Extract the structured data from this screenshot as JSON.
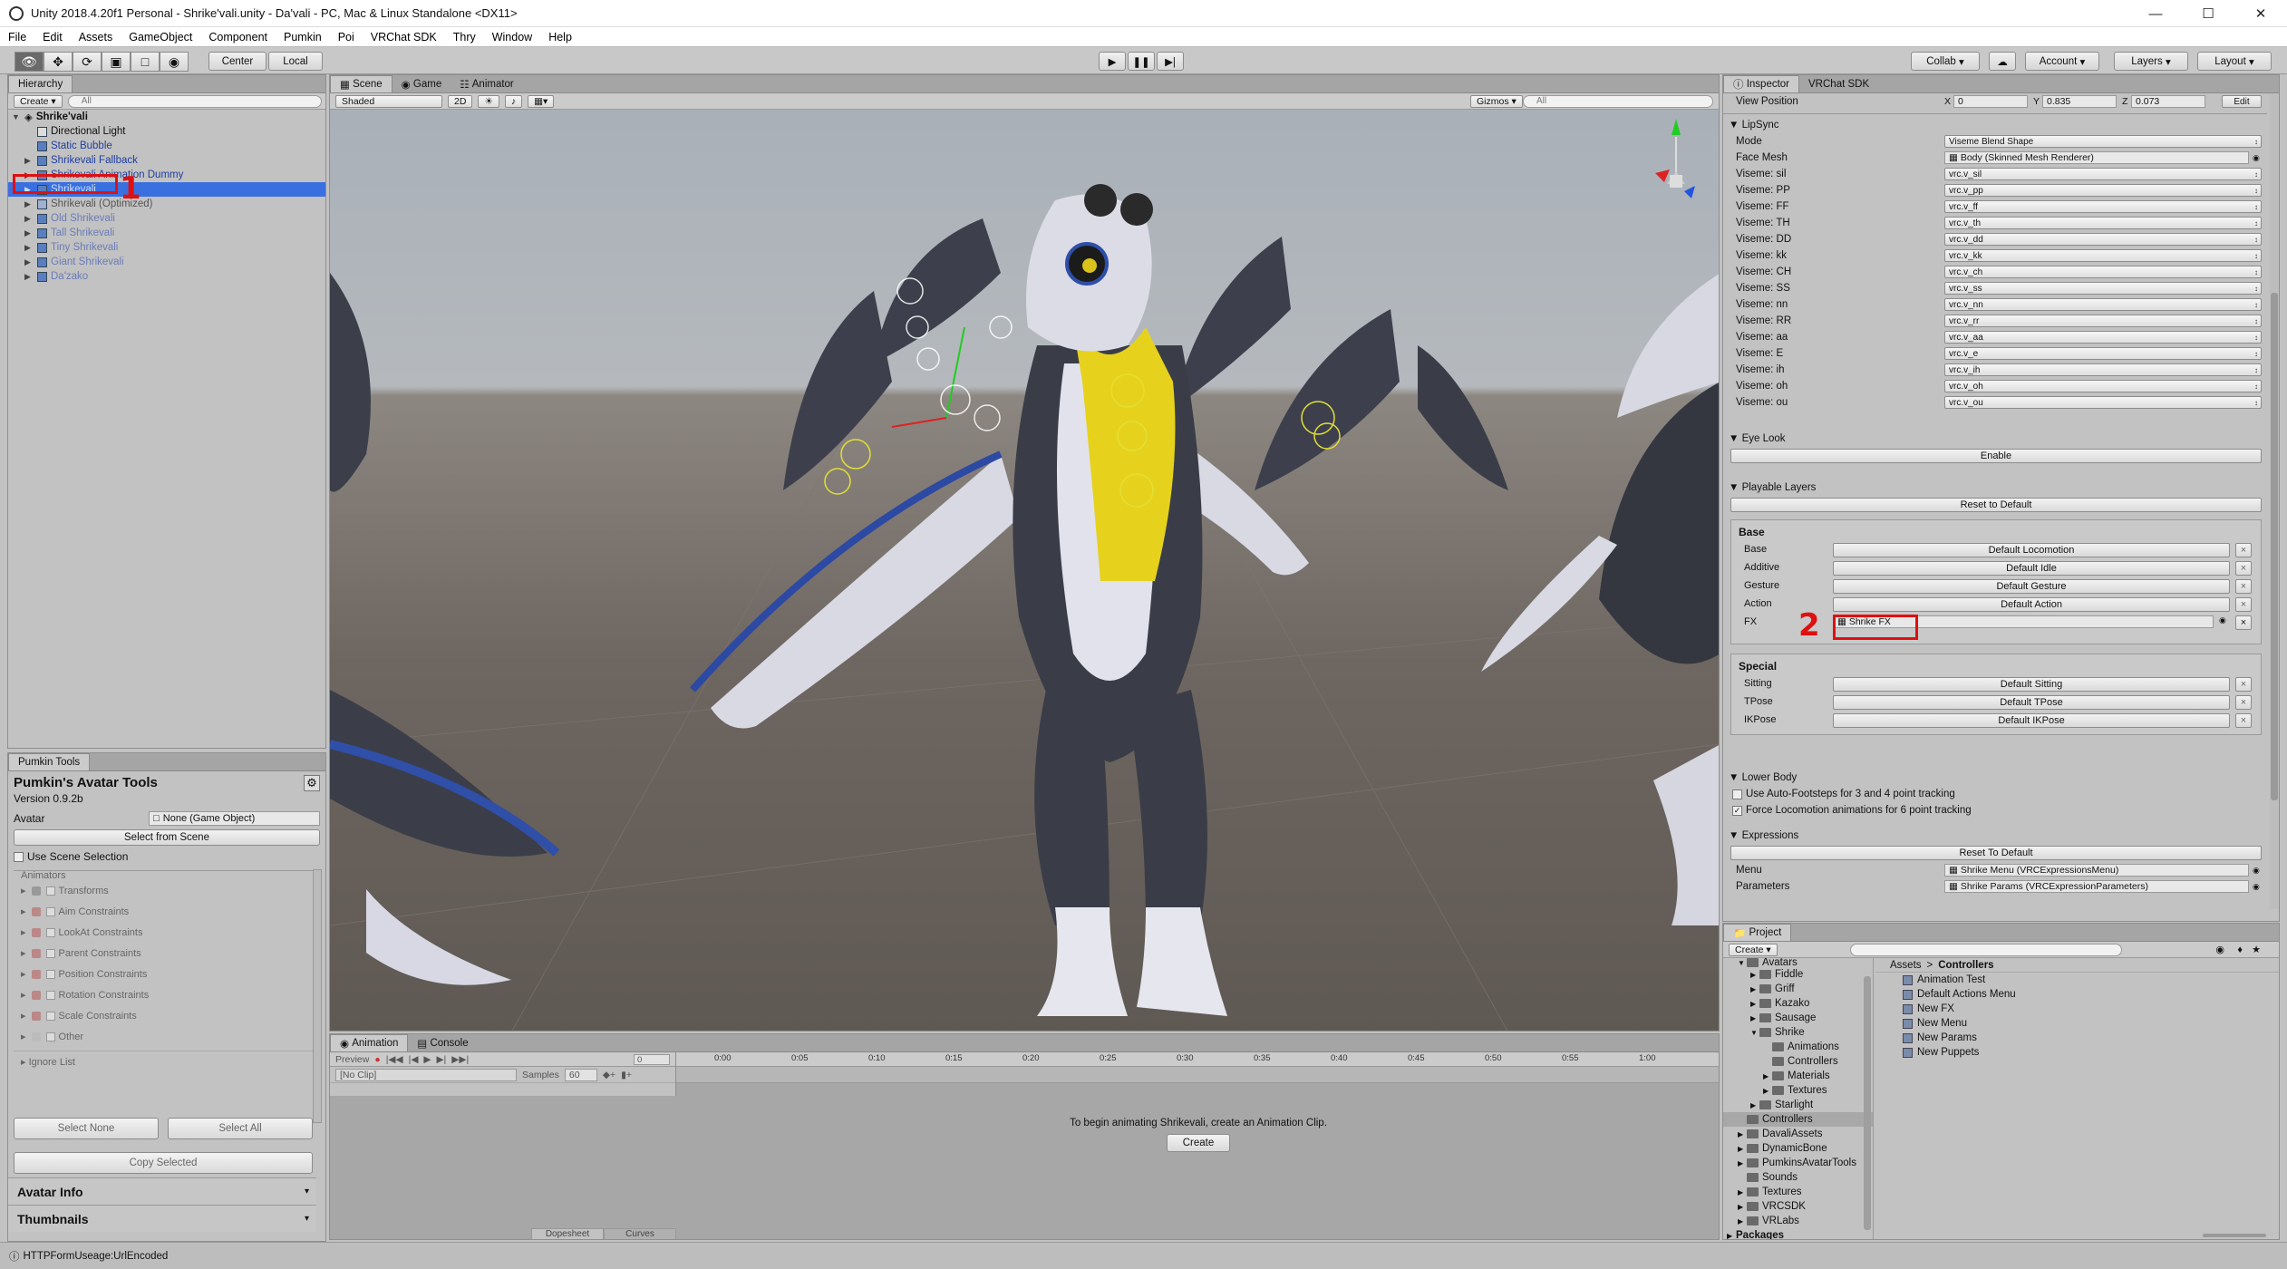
{
  "window": {
    "title": "Unity 2018.4.20f1 Personal - Shrike'vali.unity - Da'vali - PC, Mac & Linux Standalone <DX11>"
  },
  "menu": [
    "File",
    "Edit",
    "Assets",
    "GameObject",
    "Component",
    "Pumkin",
    "Poi",
    "VRChat SDK",
    "Thry",
    "Window",
    "Help"
  ],
  "toolbar": {
    "pivot": "Center",
    "space": "Local",
    "collab": "Collab",
    "account": "Account",
    "layers": "Layers",
    "layout": "Layout"
  },
  "hierarchy": {
    "tab": "Hierarchy",
    "create": "Create",
    "search_placeholder": "All",
    "root": "Shrike'vali",
    "items": [
      {
        "label": "Directional Light"
      },
      {
        "label": "Static Bubble"
      },
      {
        "label": "Shrikevali Fallback"
      },
      {
        "label": "Shrikevali Animation Dummy"
      },
      {
        "label": "Shrikevali"
      },
      {
        "label": "Shrikevali (Optimized)"
      },
      {
        "label": "Old Shrikevali"
      },
      {
        "label": "Tall Shrikevali"
      },
      {
        "label": "Tiny Shrikevali"
      },
      {
        "label": "Giant Shrikevali"
      },
      {
        "label": "Da'zako"
      }
    ]
  },
  "pumkin": {
    "tab": "Pumkin Tools",
    "title": "Pumkin's Avatar Tools",
    "version": "Version 0.9.2b",
    "avatar_label": "Avatar",
    "avatar_value": "None (Game Object)",
    "select_from_scene": "Select from Scene",
    "use_scene_selection": "Use Scene Selection",
    "list": [
      "Animators",
      "Transforms",
      "Aim Constraints",
      "LookAt Constraints",
      "Parent Constraints",
      "Position Constraints",
      "Rotation Constraints",
      "Scale Constraints",
      "Other"
    ],
    "ignore_list": "Ignore List",
    "select_none": "Select None",
    "select_all": "Select All",
    "copy_selected": "Copy Selected",
    "avatar_info": "Avatar Info",
    "thumbnails": "Thumbnails"
  },
  "scene": {
    "tabs": [
      "Scene",
      "Game",
      "Animator"
    ],
    "shading": "Shaded",
    "mode_2d": "2D",
    "gizmos": "Gizmos",
    "search_placeholder": "All"
  },
  "animation": {
    "tabs": [
      "Animation",
      "Console"
    ],
    "preview": "Preview",
    "clip": "[No Clip]",
    "samples_label": "Samples",
    "samples_value": "60",
    "frame": "0",
    "ticks": [
      "0:00",
      "0:05",
      "0:10",
      "0:15",
      "0:20",
      "0:25",
      "0:30",
      "0:35",
      "0:40",
      "0:45",
      "0:50",
      "0:55",
      "1:00"
    ],
    "message": "To begin animating Shrikevali, create an Animation Clip.",
    "create": "Create",
    "dopesheet": "Dopesheet",
    "curves": "Curves"
  },
  "inspector": {
    "tabs": [
      "Inspector",
      "VRChat SDK"
    ],
    "view_position": {
      "label": "View Position",
      "x": "0",
      "y": "0.835",
      "z": "0.073",
      "edit": "Edit"
    },
    "lipsync": {
      "title": "LipSync",
      "mode_label": "Mode",
      "mode_value": "Viseme Blend Shape",
      "face_mesh_label": "Face Mesh",
      "face_mesh_value": "Body (Skinned Mesh Renderer)",
      "visemes": [
        {
          "label": "Viseme: sil",
          "value": "vrc.v_sil"
        },
        {
          "label": "Viseme: PP",
          "value": "vrc.v_pp"
        },
        {
          "label": "Viseme: FF",
          "value": "vrc.v_ff"
        },
        {
          "label": "Viseme: TH",
          "value": "vrc.v_th"
        },
        {
          "label": "Viseme: DD",
          "value": "vrc.v_dd"
        },
        {
          "label": "Viseme: kk",
          "value": "vrc.v_kk"
        },
        {
          "label": "Viseme: CH",
          "value": "vrc.v_ch"
        },
        {
          "label": "Viseme: SS",
          "value": "vrc.v_ss"
        },
        {
          "label": "Viseme: nn",
          "value": "vrc.v_nn"
        },
        {
          "label": "Viseme: RR",
          "value": "vrc.v_rr"
        },
        {
          "label": "Viseme: aa",
          "value": "vrc.v_aa"
        },
        {
          "label": "Viseme: E",
          "value": "vrc.v_e"
        },
        {
          "label": "Viseme: ih",
          "value": "vrc.v_ih"
        },
        {
          "label": "Viseme: oh",
          "value": "vrc.v_oh"
        },
        {
          "label": "Viseme: ou",
          "value": "vrc.v_ou"
        }
      ]
    },
    "eye_look": {
      "title": "Eye Look",
      "enable": "Enable"
    },
    "playable_layers": {
      "title": "Playable Layers",
      "reset": "Reset to Default",
      "base_title": "Base",
      "base": [
        {
          "label": "Base",
          "value": "Default Locomotion"
        },
        {
          "label": "Additive",
          "value": "Default Idle"
        },
        {
          "label": "Gesture",
          "value": "Default Gesture"
        },
        {
          "label": "Action",
          "value": "Default Action"
        },
        {
          "label": "FX",
          "value": "Shrike FX"
        }
      ],
      "special_title": "Special",
      "special": [
        {
          "label": "Sitting",
          "value": "Default Sitting"
        },
        {
          "label": "TPose",
          "value": "Default TPose"
        },
        {
          "label": "IKPose",
          "value": "Default IKPose"
        }
      ]
    },
    "lower_body": {
      "title": "Lower Body",
      "auto_footsteps": "Use Auto-Footsteps for 3 and 4 point tracking",
      "force_locomotion": "Force Locomotion animations for 6 point tracking"
    },
    "expressions": {
      "title": "Expressions",
      "reset": "Reset To Default",
      "menu_label": "Menu",
      "menu_value": "Shrike Menu (VRCExpressionsMenu)",
      "params_label": "Parameters",
      "params_value": "Shrike Params (VRCExpressionParameters)"
    }
  },
  "project": {
    "tab": "Project",
    "create": "Create",
    "tree": [
      {
        "label": "Avatars",
        "indent": 1
      },
      {
        "label": "Fiddle",
        "indent": 2
      },
      {
        "label": "Griff",
        "indent": 2
      },
      {
        "label": "Kazako",
        "indent": 2
      },
      {
        "label": "Sausage",
        "indent": 2
      },
      {
        "label": "Shrike",
        "indent": 2
      },
      {
        "label": "Animations",
        "indent": 3
      },
      {
        "label": "Controllers",
        "indent": 3
      },
      {
        "label": "Materials",
        "indent": 3
      },
      {
        "label": "Textures",
        "indent": 3
      },
      {
        "label": "Starlight",
        "indent": 2
      },
      {
        "label": "Controllers",
        "indent": 1
      },
      {
        "label": "DavaliAssets",
        "indent": 1
      },
      {
        "label": "DynamicBone",
        "indent": 1
      },
      {
        "label": "PumkinsAvatarTools",
        "indent": 1
      },
      {
        "label": "Sounds",
        "indent": 1
      },
      {
        "label": "Textures",
        "indent": 1
      },
      {
        "label": "VRCSDK",
        "indent": 1
      },
      {
        "label": "VRLabs",
        "indent": 1
      }
    ],
    "packages": "Packages",
    "breadcrumb_root": "Assets",
    "breadcrumb_sep": ">",
    "breadcrumb_current": "Controllers",
    "assets": [
      "Animation Test",
      "Default Actions Menu",
      "New FX",
      "New Menu",
      "New Params",
      "New Puppets"
    ]
  },
  "status": {
    "text": "HTTPFormUseage:UrlEncoded"
  },
  "annotations": {
    "one": "1",
    "two": "2"
  }
}
